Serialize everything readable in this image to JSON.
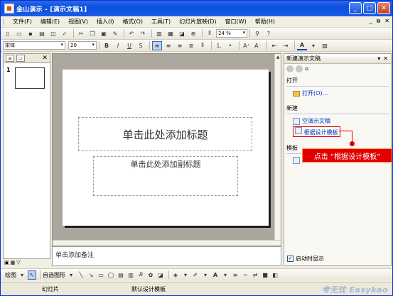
{
  "window": {
    "title": "金山演示 - [演示文稿1]",
    "buttons": {
      "minimize": "_",
      "maximize": "□",
      "close": "✕"
    }
  },
  "menubar": {
    "items": [
      "文件(F)",
      "编辑(E)",
      "视图(V)",
      "插入(I)",
      "格式(O)",
      "工具(T)",
      "幻灯片放映(D)",
      "窗口(W)",
      "帮助(H)"
    ],
    "right_controls": [
      "_",
      "⧉",
      "✕"
    ]
  },
  "toolbar": {
    "zoom_value": "24 %"
  },
  "format_toolbar": {
    "font_name": "宋体",
    "font_size": "20",
    "bold": "B",
    "italic": "I",
    "underline": "U",
    "shadow": "S",
    "grow_font": "A⁺",
    "shrink_font": "A⁻",
    "font_color": "A"
  },
  "sidebar": {
    "slide_number": "1"
  },
  "slide": {
    "title_placeholder": "单击此处添加标题",
    "subtitle_placeholder": "单击此处添加副标题"
  },
  "notes": {
    "placeholder": "单击添加备注"
  },
  "taskpane": {
    "title": "新建演示文稿",
    "sections": {
      "open": {
        "heading": "打开",
        "link": "打开(O)..."
      },
      "new": {
        "heading": "新建",
        "blank": "空演示文稿",
        "from_design": "根据设计模板"
      },
      "templates": {
        "heading": "模板"
      }
    },
    "show_at_startup": "启动时显示"
  },
  "callout": {
    "text": "点击 “根据设计模板”",
    "color": "#e00000"
  },
  "drawing_toolbar": {
    "draw_label": "绘图",
    "autoshapes_label": "自选图形"
  },
  "statusbar": {
    "slide_label": "幻灯片",
    "template_label": "默认设计模板",
    "watermark": "考无忧 Easykao"
  }
}
